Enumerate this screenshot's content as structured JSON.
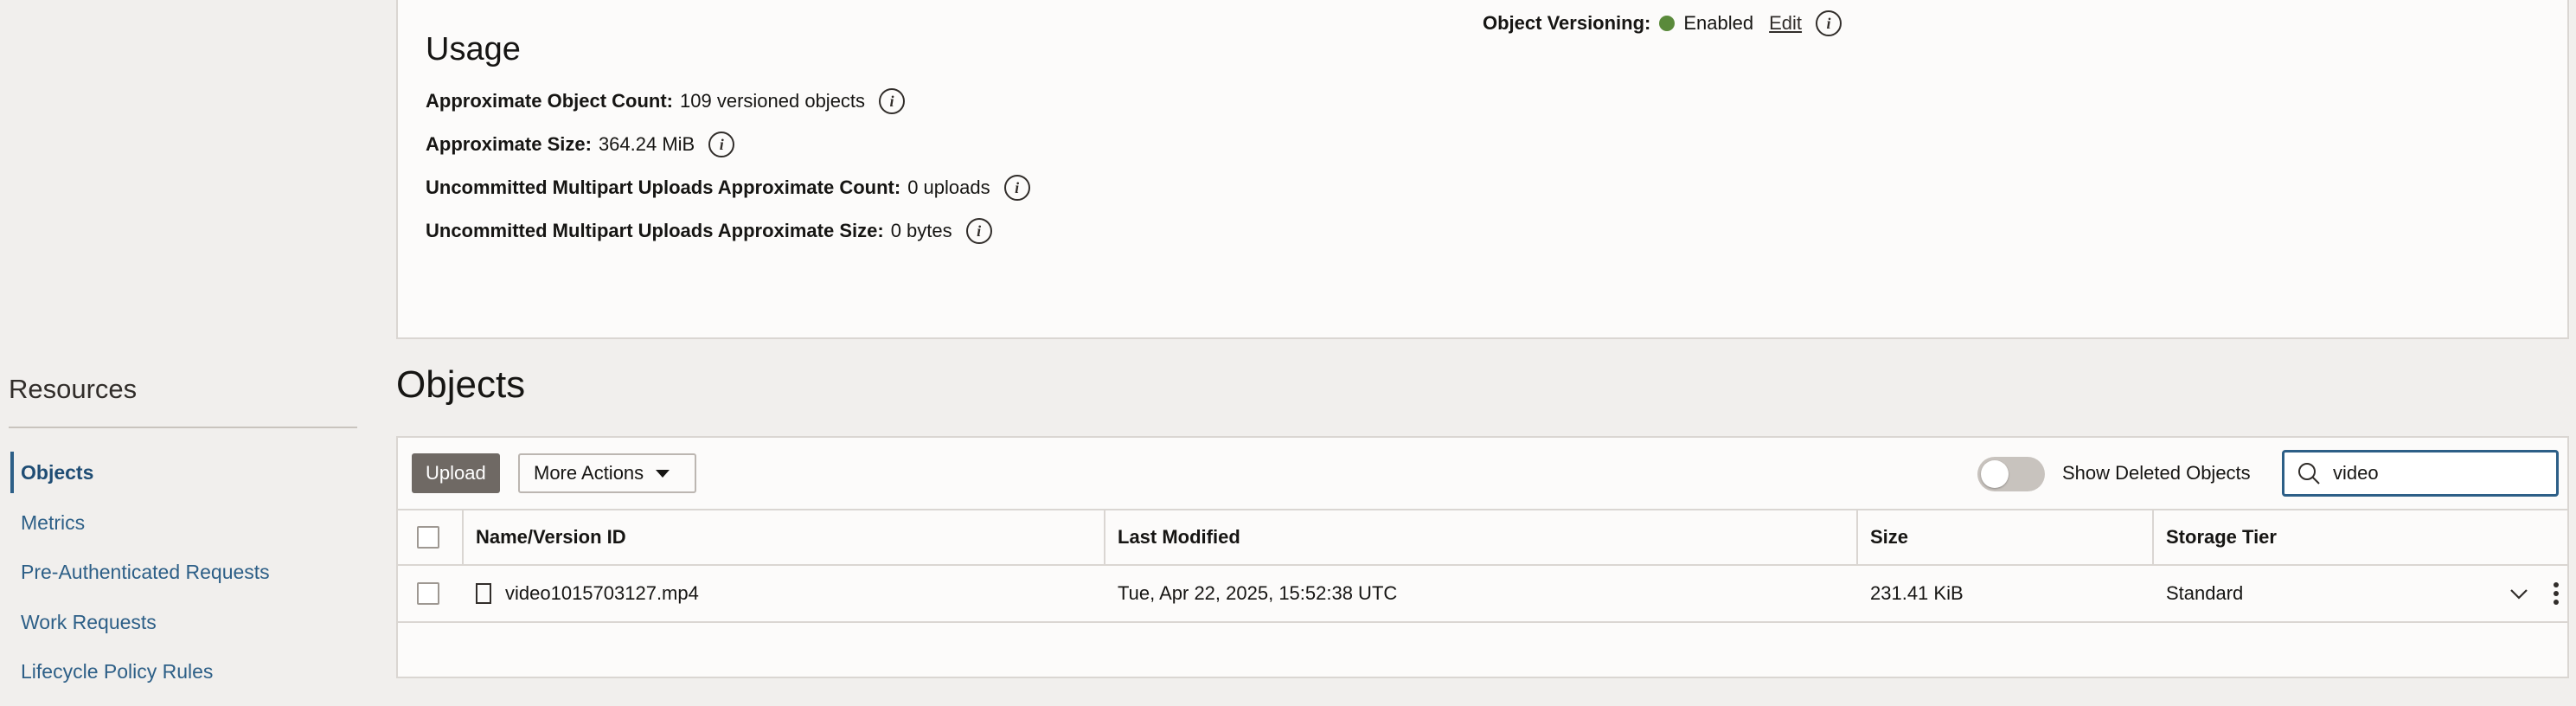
{
  "sidebar": {
    "title": "Resources",
    "items": [
      {
        "label": "Objects",
        "active": true
      },
      {
        "label": "Metrics"
      },
      {
        "label": "Pre-Authenticated Requests"
      },
      {
        "label": "Work Requests"
      },
      {
        "label": "Lifecycle Policy Rules"
      }
    ]
  },
  "usage": {
    "title": "Usage",
    "object_count_label": "Approximate Object Count:",
    "object_count_value": "109 versioned objects",
    "size_label": "Approximate Size:",
    "size_value": "364.24 MiB",
    "multipart_count_label": "Uncommitted Multipart Uploads Approximate Count:",
    "multipart_count_value": "0 uploads",
    "multipart_size_label": "Uncommitted Multipart Uploads Approximate Size:",
    "multipart_size_value": "0 bytes",
    "versioning_label": "Object Versioning:",
    "versioning_status": "Enabled",
    "versioning_edit": "Edit",
    "status_color": "#5a8a3b"
  },
  "objects": {
    "title": "Objects",
    "upload_label": "Upload",
    "more_actions_label": "More Actions",
    "show_deleted_label": "Show Deleted Objects",
    "show_deleted_on": false,
    "search_value": "video",
    "columns": [
      "Name/Version ID",
      "Last Modified",
      "Size",
      "Storage Tier"
    ],
    "rows": [
      {
        "name": "video1015703127.mp4",
        "modified": "Tue, Apr 22, 2025, 15:52:38 UTC",
        "size": "231.41 KiB",
        "tier": "Standard"
      }
    ]
  },
  "icons": [
    "info-icon",
    "search-icon",
    "file-icon",
    "chevron-down-icon",
    "kebab-menu-icon",
    "caret-down-icon"
  ],
  "accent_color": "#2d5f87"
}
